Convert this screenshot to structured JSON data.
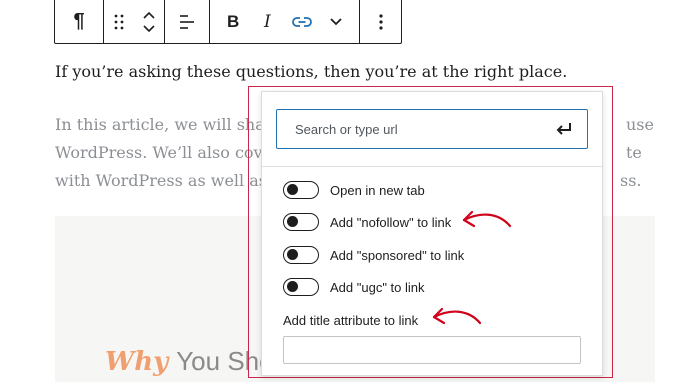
{
  "toolbar": {
    "buttons": [
      {
        "name": "paragraph",
        "glyph": "¶"
      },
      {
        "name": "drag",
        "glyph": "⠿"
      },
      {
        "name": "move",
        "glyph": "⌃⌄"
      },
      {
        "name": "align",
        "glyph": "≡"
      },
      {
        "name": "bold",
        "glyph": "B"
      },
      {
        "name": "italic",
        "glyph": "I"
      },
      {
        "name": "link",
        "glyph": "🔗"
      },
      {
        "name": "more-rich-text",
        "glyph": "⌄"
      },
      {
        "name": "options",
        "glyph": "⋮"
      }
    ]
  },
  "content": {
    "para1": "If you’re asking these questions, then you’re at the right place.",
    "para2_line1_left": "In this article, we will share",
    "para2_line1_right": "use",
    "para2_line2_left": "WordPress. We’ll also cover",
    "para2_line2_right": "te",
    "para2_line3_left": "with WordPress as well as s",
    "para2_line3_right": "ss.",
    "image_caption_why": "Why",
    "image_caption_rest": "You Shou"
  },
  "link_popover": {
    "search_placeholder": "Search or type url",
    "options": [
      {
        "label": "Open in new tab",
        "checked": false
      },
      {
        "label": "Add \"nofollow\" to link",
        "checked": false
      },
      {
        "label": "Add \"sponsored\" to link",
        "checked": false
      },
      {
        "label": "Add \"ugc\" to link",
        "checked": false
      }
    ],
    "title_label": "Add title attribute to link",
    "title_value": ""
  },
  "colors": {
    "accent": "#2271b1",
    "highlight": "#c8264a",
    "annotation_arrow": "#d0021b"
  }
}
